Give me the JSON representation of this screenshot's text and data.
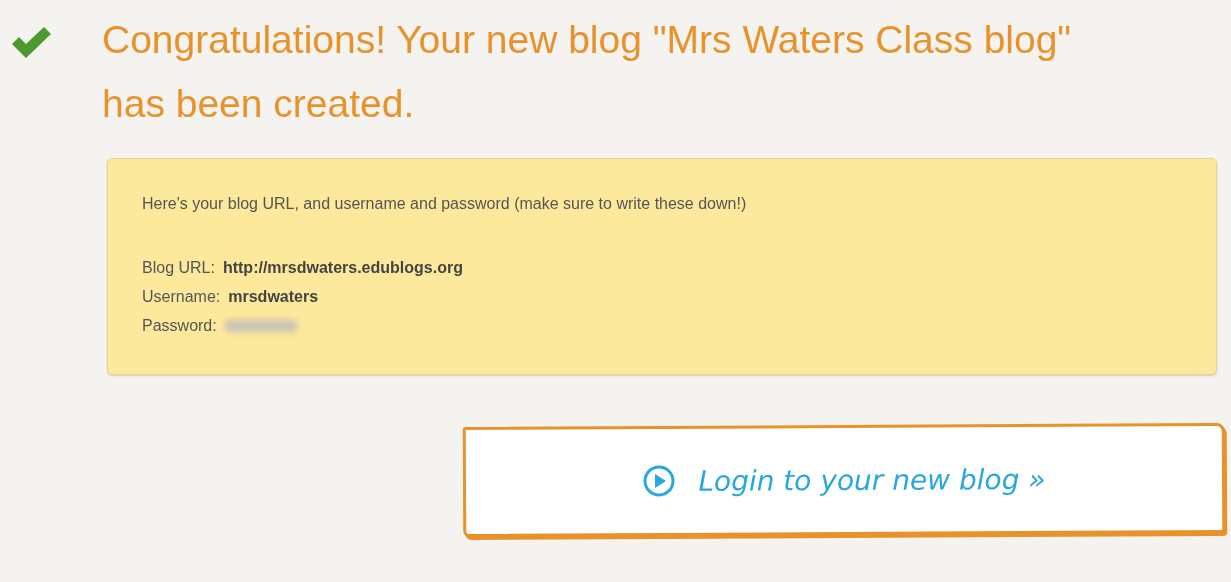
{
  "heading": {
    "text": "Congratulations! Your new blog \"Mrs Waters Class blog\" has been created."
  },
  "details": {
    "intro": "Here's your blog URL, and username and password (make sure to write these down!)",
    "fields": [
      {
        "label": "Blog URL:",
        "value": "http://mrsdwaters.edublogs.org",
        "kind": "text"
      },
      {
        "label": "Username:",
        "value": "mrsdwaters",
        "kind": "text"
      },
      {
        "label": "Password:",
        "kind": "hidden"
      }
    ]
  },
  "login_button": {
    "label": "Login to your new blog »"
  }
}
